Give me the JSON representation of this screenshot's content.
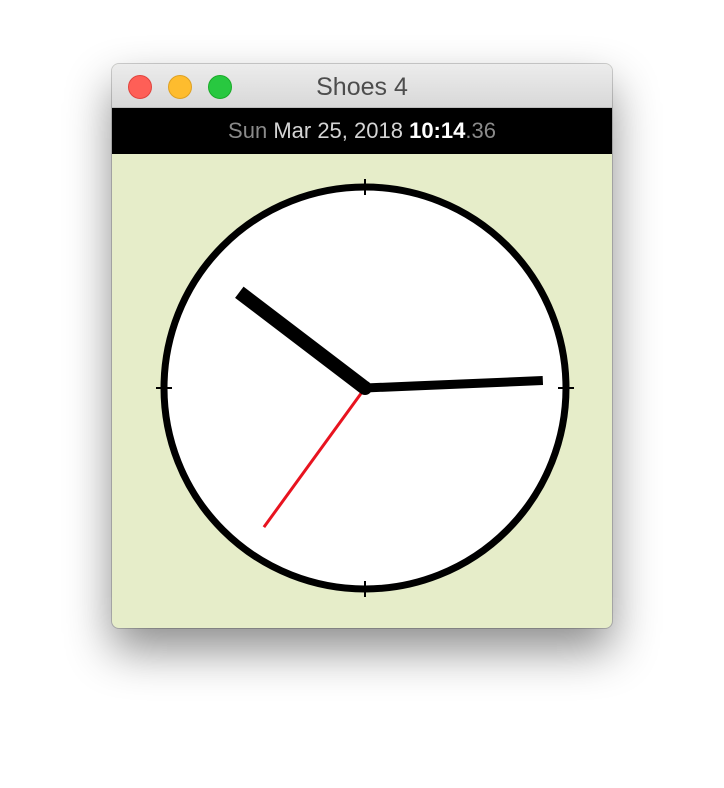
{
  "window": {
    "title": "Shoes 4"
  },
  "datebar": {
    "weekday": "Sun",
    "date": "Mar 25, 2018",
    "hour_minute": "10:14",
    "seconds": ".36"
  },
  "clock": {
    "hours": 10,
    "minutes": 14,
    "seconds": 36,
    "hand_colors": {
      "hour": "#000000",
      "minute": "#000000",
      "second": "#e8131f"
    },
    "face_color": "#ffffff",
    "rim_color": "#000000"
  },
  "colors": {
    "background": "#e6edc9",
    "datebar": "#000000"
  }
}
